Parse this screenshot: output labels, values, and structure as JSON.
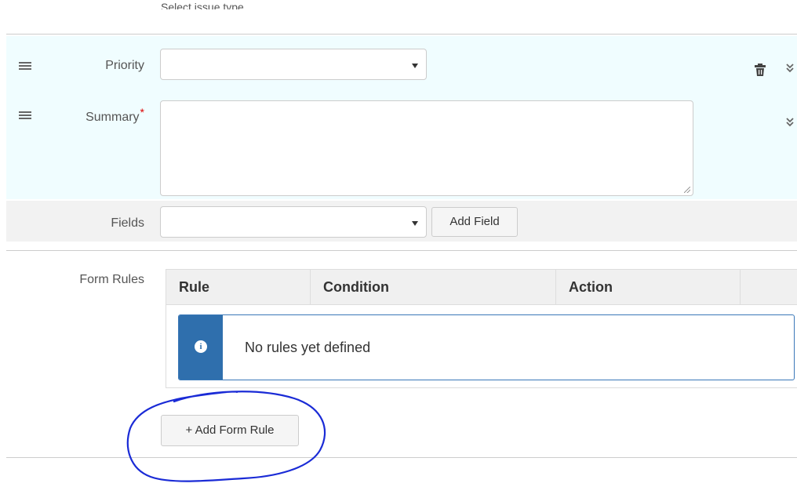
{
  "top": {
    "cut_text": "Select issue type"
  },
  "priority_row": {
    "label": "Priority",
    "select_value": ""
  },
  "summary_row": {
    "label": "Summary",
    "required_mark": "*",
    "value": ""
  },
  "fields_row": {
    "label": "Fields",
    "select_value": "",
    "add_button": "Add Field"
  },
  "form_rules": {
    "label": "Form Rules",
    "columns": [
      "Rule",
      "Condition",
      "Action"
    ],
    "empty_message": "No rules yet defined",
    "add_button": "+ Add Form Rule"
  },
  "icons": {
    "drag": "drag-handle-icon",
    "trash": "trash-icon",
    "chevron": "double-chevron-down-icon",
    "info": "info-circle-icon"
  },
  "colors": {
    "field_highlight": "#f0fdff",
    "alert_accent": "#2f6fad",
    "annotation": "#1a2bd6"
  }
}
